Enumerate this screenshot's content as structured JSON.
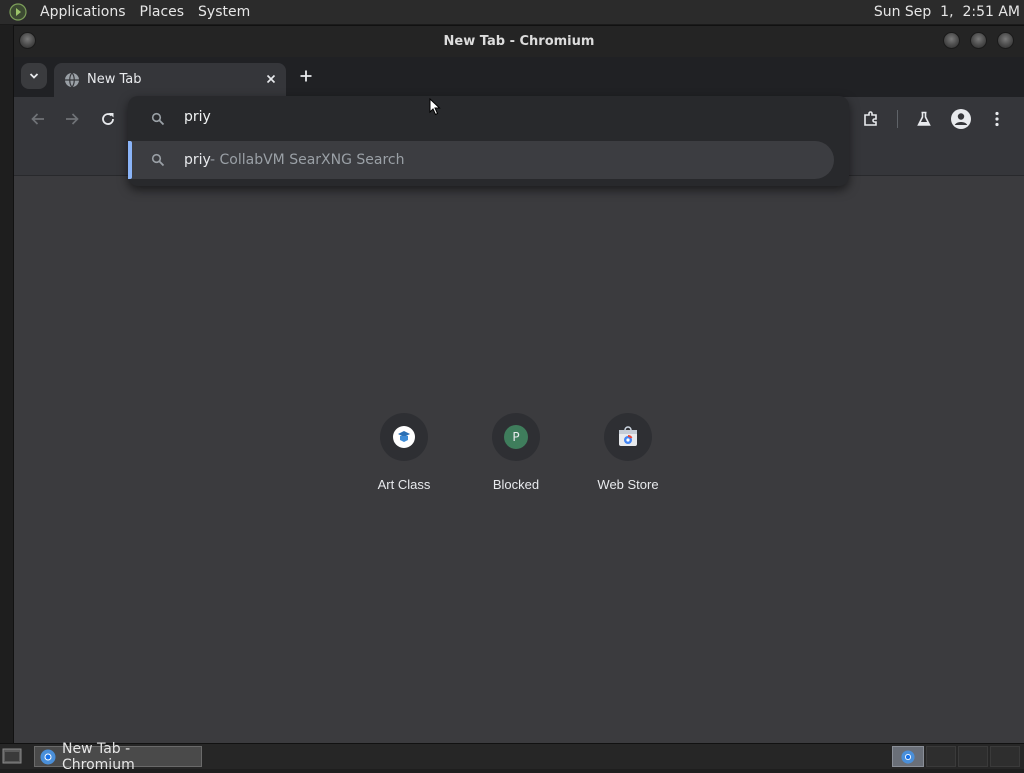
{
  "top_panel": {
    "menus": [
      "Applications",
      "Places",
      "System"
    ],
    "clock": "Sun Sep  1,  2:51 AM"
  },
  "window": {
    "title": "New Tab - Chromium"
  },
  "tabs": [
    {
      "title": "New Tab",
      "icon": "globe-icon",
      "active": true
    }
  ],
  "omnibox": {
    "input_text": "priy",
    "suggestion": {
      "query": "priy",
      "description": "- CollabVM SearXNG Search",
      "icon": "search-icon"
    }
  },
  "shortcuts": [
    {
      "label": "Art Class",
      "icon": "art-class-icon",
      "letter": ""
    },
    {
      "label": "Blocked",
      "icon": "letter-avatar-icon",
      "letter": "P",
      "color": "#3f7d5c"
    },
    {
      "label": "Web Store",
      "icon": "web-store-icon",
      "letter": ""
    }
  ],
  "taskbar": {
    "task_title": "New Tab - Chromium"
  },
  "colors": {
    "accent": "#8ab4f8",
    "ntp_background": "#3b3b3e",
    "toolbar": "#35363a"
  }
}
